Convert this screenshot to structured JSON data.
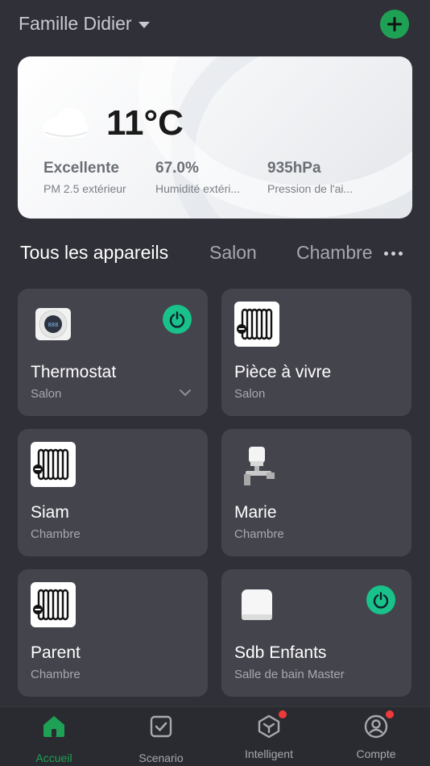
{
  "header": {
    "home_name": "Famille Didier"
  },
  "weather": {
    "temperature": "11°C",
    "metrics": [
      {
        "value": "Excellente",
        "label": "PM 2.5 extérieur"
      },
      {
        "value": "67.0%",
        "label": "Humidité extéri..."
      },
      {
        "value": "935hPa",
        "label": "Pression de l'ai..."
      }
    ]
  },
  "tabs": [
    "Tous les appareils",
    "Salon",
    "Chambre"
  ],
  "devices": [
    {
      "name": "Thermostat",
      "room": "Salon",
      "icon": "thermostat-icon",
      "power": true
    },
    {
      "name": "Pièce à vivre",
      "room": "Salon",
      "icon": "radiator-icon",
      "power": false
    },
    {
      "name": "Siam",
      "room": "Chambre",
      "icon": "radiator-icon",
      "power": false
    },
    {
      "name": "Marie",
      "room": "Chambre",
      "icon": "valve-icon",
      "power": false
    },
    {
      "name": "Parent",
      "room": "Chambre",
      "icon": "radiator-icon",
      "power": false
    },
    {
      "name": "Sdb Enfants",
      "room": "Salle de bain Master",
      "icon": "sensor-icon",
      "power": true
    }
  ],
  "bottom_nav": [
    {
      "label": "Accueil",
      "icon": "home-icon",
      "active": true
    },
    {
      "label": "Scenario",
      "icon": "checkbox-icon",
      "active": false
    },
    {
      "label": "Intelligent",
      "icon": "cube-icon",
      "active": false,
      "badge": true
    },
    {
      "label": "Compte",
      "icon": "account-icon",
      "active": false,
      "badge": true
    }
  ],
  "colors": {
    "accent": "#1fa155",
    "power": "#18c28a",
    "card": "#44444d",
    "background": "#303038"
  }
}
